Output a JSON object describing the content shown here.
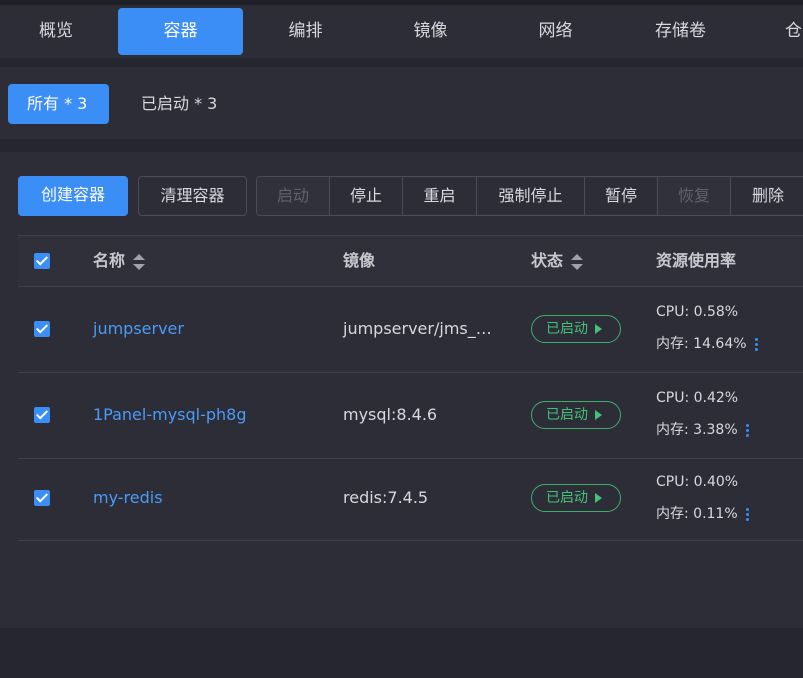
{
  "topnav": {
    "tabs": [
      "概览",
      "容器",
      "编排",
      "镜像",
      "网络",
      "存储卷",
      "仓"
    ]
  },
  "filters": {
    "all": "所有 * 3",
    "running": "已启动 * 3"
  },
  "toolbar": {
    "create": "创建容器",
    "prune": "清理容器",
    "start": "启动",
    "stop": "停止",
    "restart": "重启",
    "kill": "强制停止",
    "pause": "暂停",
    "resume": "恢复",
    "delete": "删除"
  },
  "table": {
    "headers": {
      "name": "名称",
      "image": "镜像",
      "status": "状态",
      "usage": "资源使用率"
    },
    "rows": [
      {
        "name": "jumpserver",
        "image": "jumpserver/jms_…",
        "status": "已启动",
        "cpu": "CPU: 0.58%",
        "mem": "内存: 14.64%"
      },
      {
        "name": "1Panel-mysql-ph8g",
        "image": "mysql:8.4.6",
        "status": "已启动",
        "cpu": "CPU: 0.42%",
        "mem": "内存: 3.38%"
      },
      {
        "name": "my-redis",
        "image": "redis:7.4.5",
        "status": "已启动",
        "cpu": "CPU: 0.40%",
        "mem": "内存: 0.11%"
      }
    ]
  },
  "colors": {
    "accent": "#3a8ef6",
    "success": "#45c279",
    "background": "#25262f",
    "panel": "#2c2d37"
  },
  "icons": [
    "checkbox-checked-icon",
    "sort-icon",
    "play-icon",
    "more-vertical-icon"
  ]
}
